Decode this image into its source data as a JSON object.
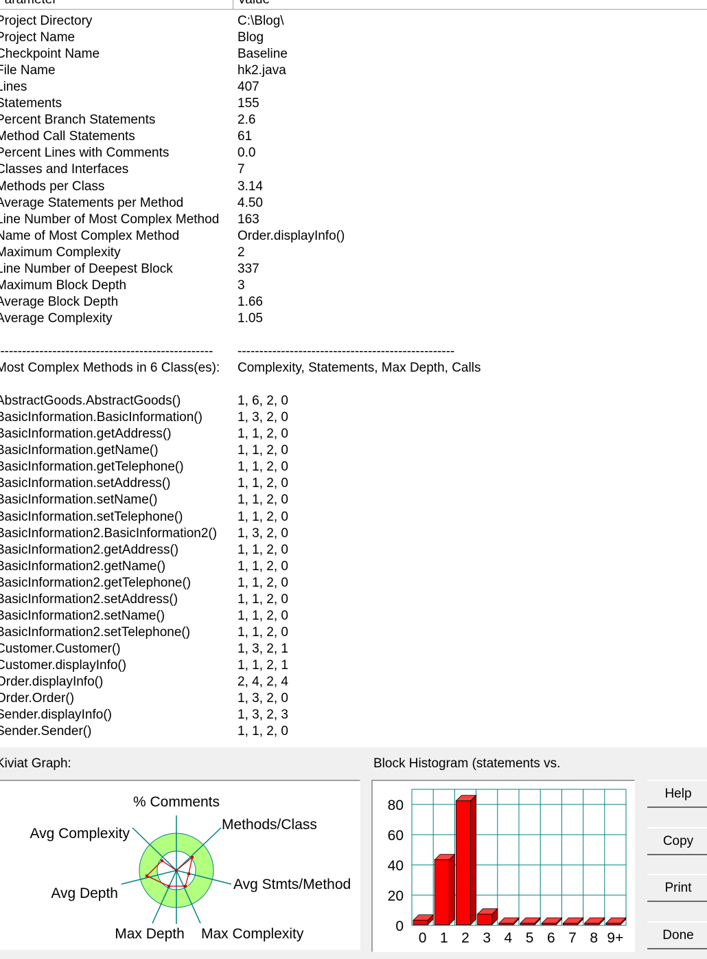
{
  "table": {
    "header": {
      "parameter": "Parameter",
      "value": "Value"
    },
    "rows": [
      {
        "param": "Project Directory",
        "value": "C:\\Blog\\"
      },
      {
        "param": "Project Name",
        "value": "Blog"
      },
      {
        "param": "Checkpoint Name",
        "value": "Baseline"
      },
      {
        "param": "File Name",
        "value": "hk2.java"
      },
      {
        "param": "Lines",
        "value": "407"
      },
      {
        "param": "Statements",
        "value": "155"
      },
      {
        "param": "Percent Branch Statements",
        "value": "2.6"
      },
      {
        "param": "Method Call Statements",
        "value": "61"
      },
      {
        "param": "Percent Lines with Comments",
        "value": "0.0"
      },
      {
        "param": "Classes and Interfaces",
        "value": "7"
      },
      {
        "param": "Methods per Class",
        "value": "3.14"
      },
      {
        "param": "Average Statements per Method",
        "value": "4.50"
      },
      {
        "param": "Line Number of Most Complex Method",
        "value": "163"
      },
      {
        "param": "Name of Most Complex Method",
        "value": "Order.displayInfo()"
      },
      {
        "param": "Maximum Complexity",
        "value": "2"
      },
      {
        "param": "Line Number of Deepest Block",
        "value": "337"
      },
      {
        "param": "Maximum Block Depth",
        "value": "3"
      },
      {
        "param": "Average Block Depth",
        "value": "1.66"
      },
      {
        "param": "Average Complexity",
        "value": "1.05"
      },
      {
        "param": "",
        "value": ""
      },
      {
        "param": "--------------------------------------------------",
        "value": "--------------------------------------------------"
      },
      {
        "param": "Most Complex Methods in 6 Class(es):",
        "value": "Complexity, Statements, Max Depth, Calls"
      },
      {
        "param": "",
        "value": ""
      },
      {
        "param": "AbstractGoods.AbstractGoods()",
        "value": "1, 6, 2, 0"
      },
      {
        "param": "BasicInformation.BasicInformation()",
        "value": "1, 3, 2, 0"
      },
      {
        "param": "BasicInformation.getAddress()",
        "value": "1, 1, 2, 0"
      },
      {
        "param": "BasicInformation.getName()",
        "value": "1, 1, 2, 0"
      },
      {
        "param": "BasicInformation.getTelephone()",
        "value": "1, 1, 2, 0"
      },
      {
        "param": "BasicInformation.setAddress()",
        "value": "1, 1, 2, 0"
      },
      {
        "param": "BasicInformation.setName()",
        "value": "1, 1, 2, 0"
      },
      {
        "param": "BasicInformation.setTelephone()",
        "value": "1, 1, 2, 0"
      },
      {
        "param": "BasicInformation2.BasicInformation2()",
        "value": "1, 3, 2, 0"
      },
      {
        "param": "BasicInformation2.getAddress()",
        "value": "1, 1, 2, 0"
      },
      {
        "param": "BasicInformation2.getName()",
        "value": "1, 1, 2, 0"
      },
      {
        "param": "BasicInformation2.getTelephone()",
        "value": "1, 1, 2, 0"
      },
      {
        "param": "BasicInformation2.setAddress()",
        "value": "1, 1, 2, 0"
      },
      {
        "param": "BasicInformation2.setName()",
        "value": "1, 1, 2, 0"
      },
      {
        "param": "BasicInformation2.setTelephone()",
        "value": "1, 1, 2, 0"
      },
      {
        "param": "Customer.Customer()",
        "value": "1, 3, 2, 1"
      },
      {
        "param": "Customer.displayInfo()",
        "value": "1, 1, 2, 1"
      },
      {
        "param": "Order.displayInfo()",
        "value": "2, 4, 2, 4"
      },
      {
        "param": "Order.Order()",
        "value": "1, 3, 2, 0"
      },
      {
        "param": "Sender.displayInfo()",
        "value": "1, 3, 2, 3"
      },
      {
        "param": "Sender.Sender()",
        "value": "1, 1, 2, 0"
      }
    ]
  },
  "kiviat": {
    "label": "Kiviat Graph:",
    "axes": [
      "% Comments",
      "Methods/Class",
      "Avg Stmts/Method",
      "Max Complexity",
      "Max Depth",
      "Avg Depth",
      "Avg Complexity"
    ],
    "ring_color": "#b3ff80",
    "plot_color": "#cc0000"
  },
  "histogram": {
    "label": "Block Histogram (statements vs.",
    "bar_color": "#ff0000",
    "grid_color": "#008080",
    "y_ticks": [
      "0",
      "20",
      "40",
      "60",
      "80"
    ],
    "chart_data": {
      "type": "bar",
      "categories": [
        "0",
        "1",
        "2",
        "3",
        "4",
        "5",
        "6",
        "7",
        "8",
        "9+"
      ],
      "values": [
        7,
        47,
        86,
        11,
        0,
        0,
        0,
        0,
        0,
        0
      ],
      "ylim": [
        0,
        90
      ]
    }
  },
  "buttons": {
    "help": "Help",
    "copy": "Copy",
    "print": "Print",
    "done": "Done"
  }
}
